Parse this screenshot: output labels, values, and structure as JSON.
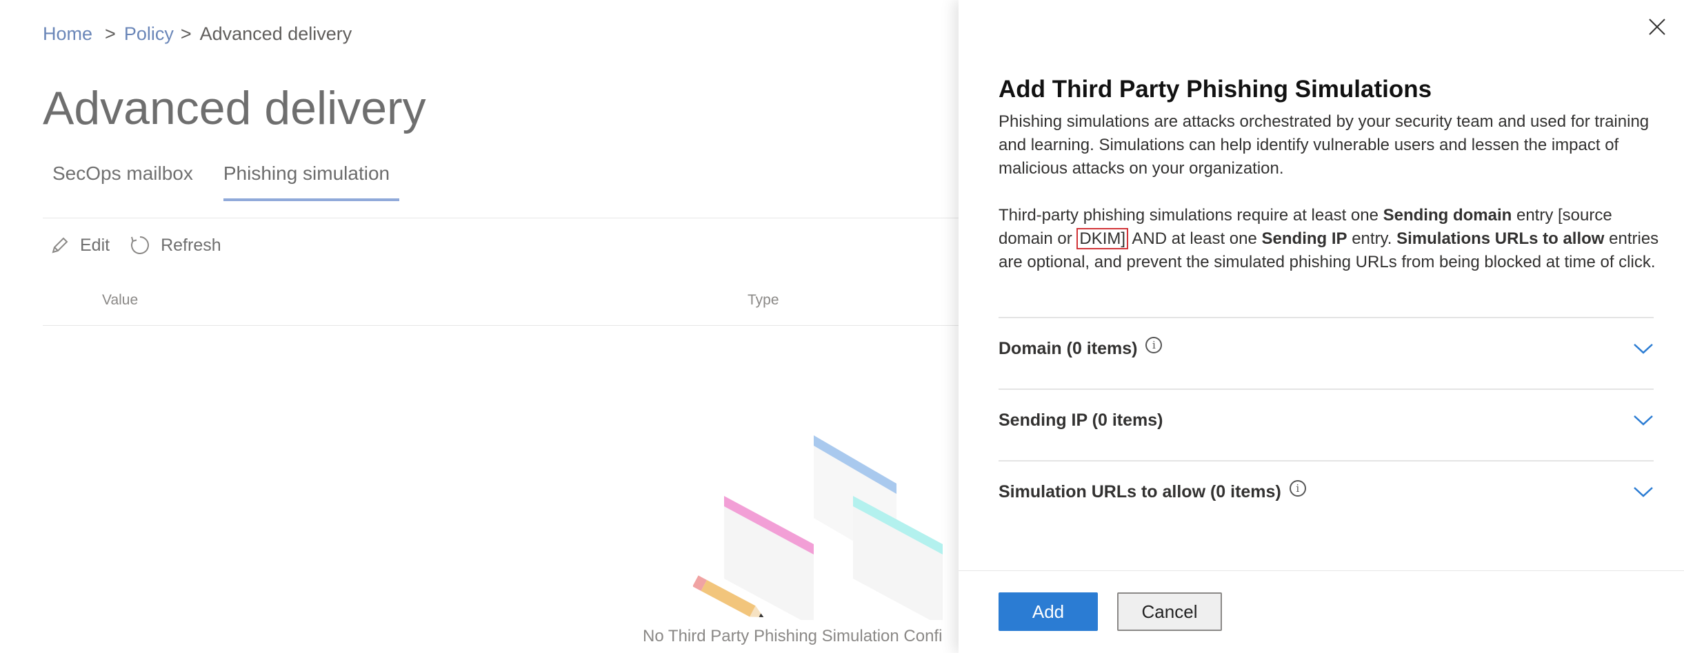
{
  "breadcrumb": {
    "home": "Home",
    "policy": "Policy",
    "current": "Advanced delivery",
    "separator": ">"
  },
  "page": {
    "title": "Advanced delivery"
  },
  "tabs": [
    {
      "label": "SecOps mailbox"
    },
    {
      "label": "Phishing simulation"
    }
  ],
  "toolbar": {
    "edit": "Edit",
    "refresh": "Refresh"
  },
  "table": {
    "columns": [
      "Value",
      "Type"
    ]
  },
  "empty_state": {
    "text": "No Third Party Phishing Simulation Confi"
  },
  "panel": {
    "title": "Add Third Party Phishing Simulations",
    "intro": "Phishing simulations are attacks orchestrated by your security team and used for training and learning. Simulations can help identify vulnerable users and lessen the impact of malicious attacks on your organization.",
    "req": {
      "t1": "Third-party phishing simulations require at least one ",
      "b1": "Sending domain",
      "t2": " entry [source domain or ",
      "dkim": "DKIM]",
      "t3": " AND at least one ",
      "b2": "Sending IP",
      "t4": " entry. ",
      "b3": "Simulations URLs to allow",
      "t5": " entries are optional, and prevent the simulated phishing URLs from being blocked at time of click."
    },
    "sections": [
      {
        "label": "Domain (0 items)",
        "info": true
      },
      {
        "label": "Sending IP (0 items)",
        "info": false
      },
      {
        "label": "Simulation URLs to allow (0 items)",
        "info": true
      }
    ],
    "info_glyph": "i",
    "buttons": {
      "add": "Add",
      "cancel": "Cancel"
    }
  },
  "colors": {
    "primary": "#2b7cd3",
    "highlight": "#d13438",
    "chevron": "#2b7cd3",
    "tab_underline": "#8fa9d9"
  },
  "icons": {
    "edit": "pencil-icon",
    "refresh": "refresh-icon",
    "close": "close-icon",
    "expand": "chevron-down-icon",
    "info": "info-icon"
  }
}
